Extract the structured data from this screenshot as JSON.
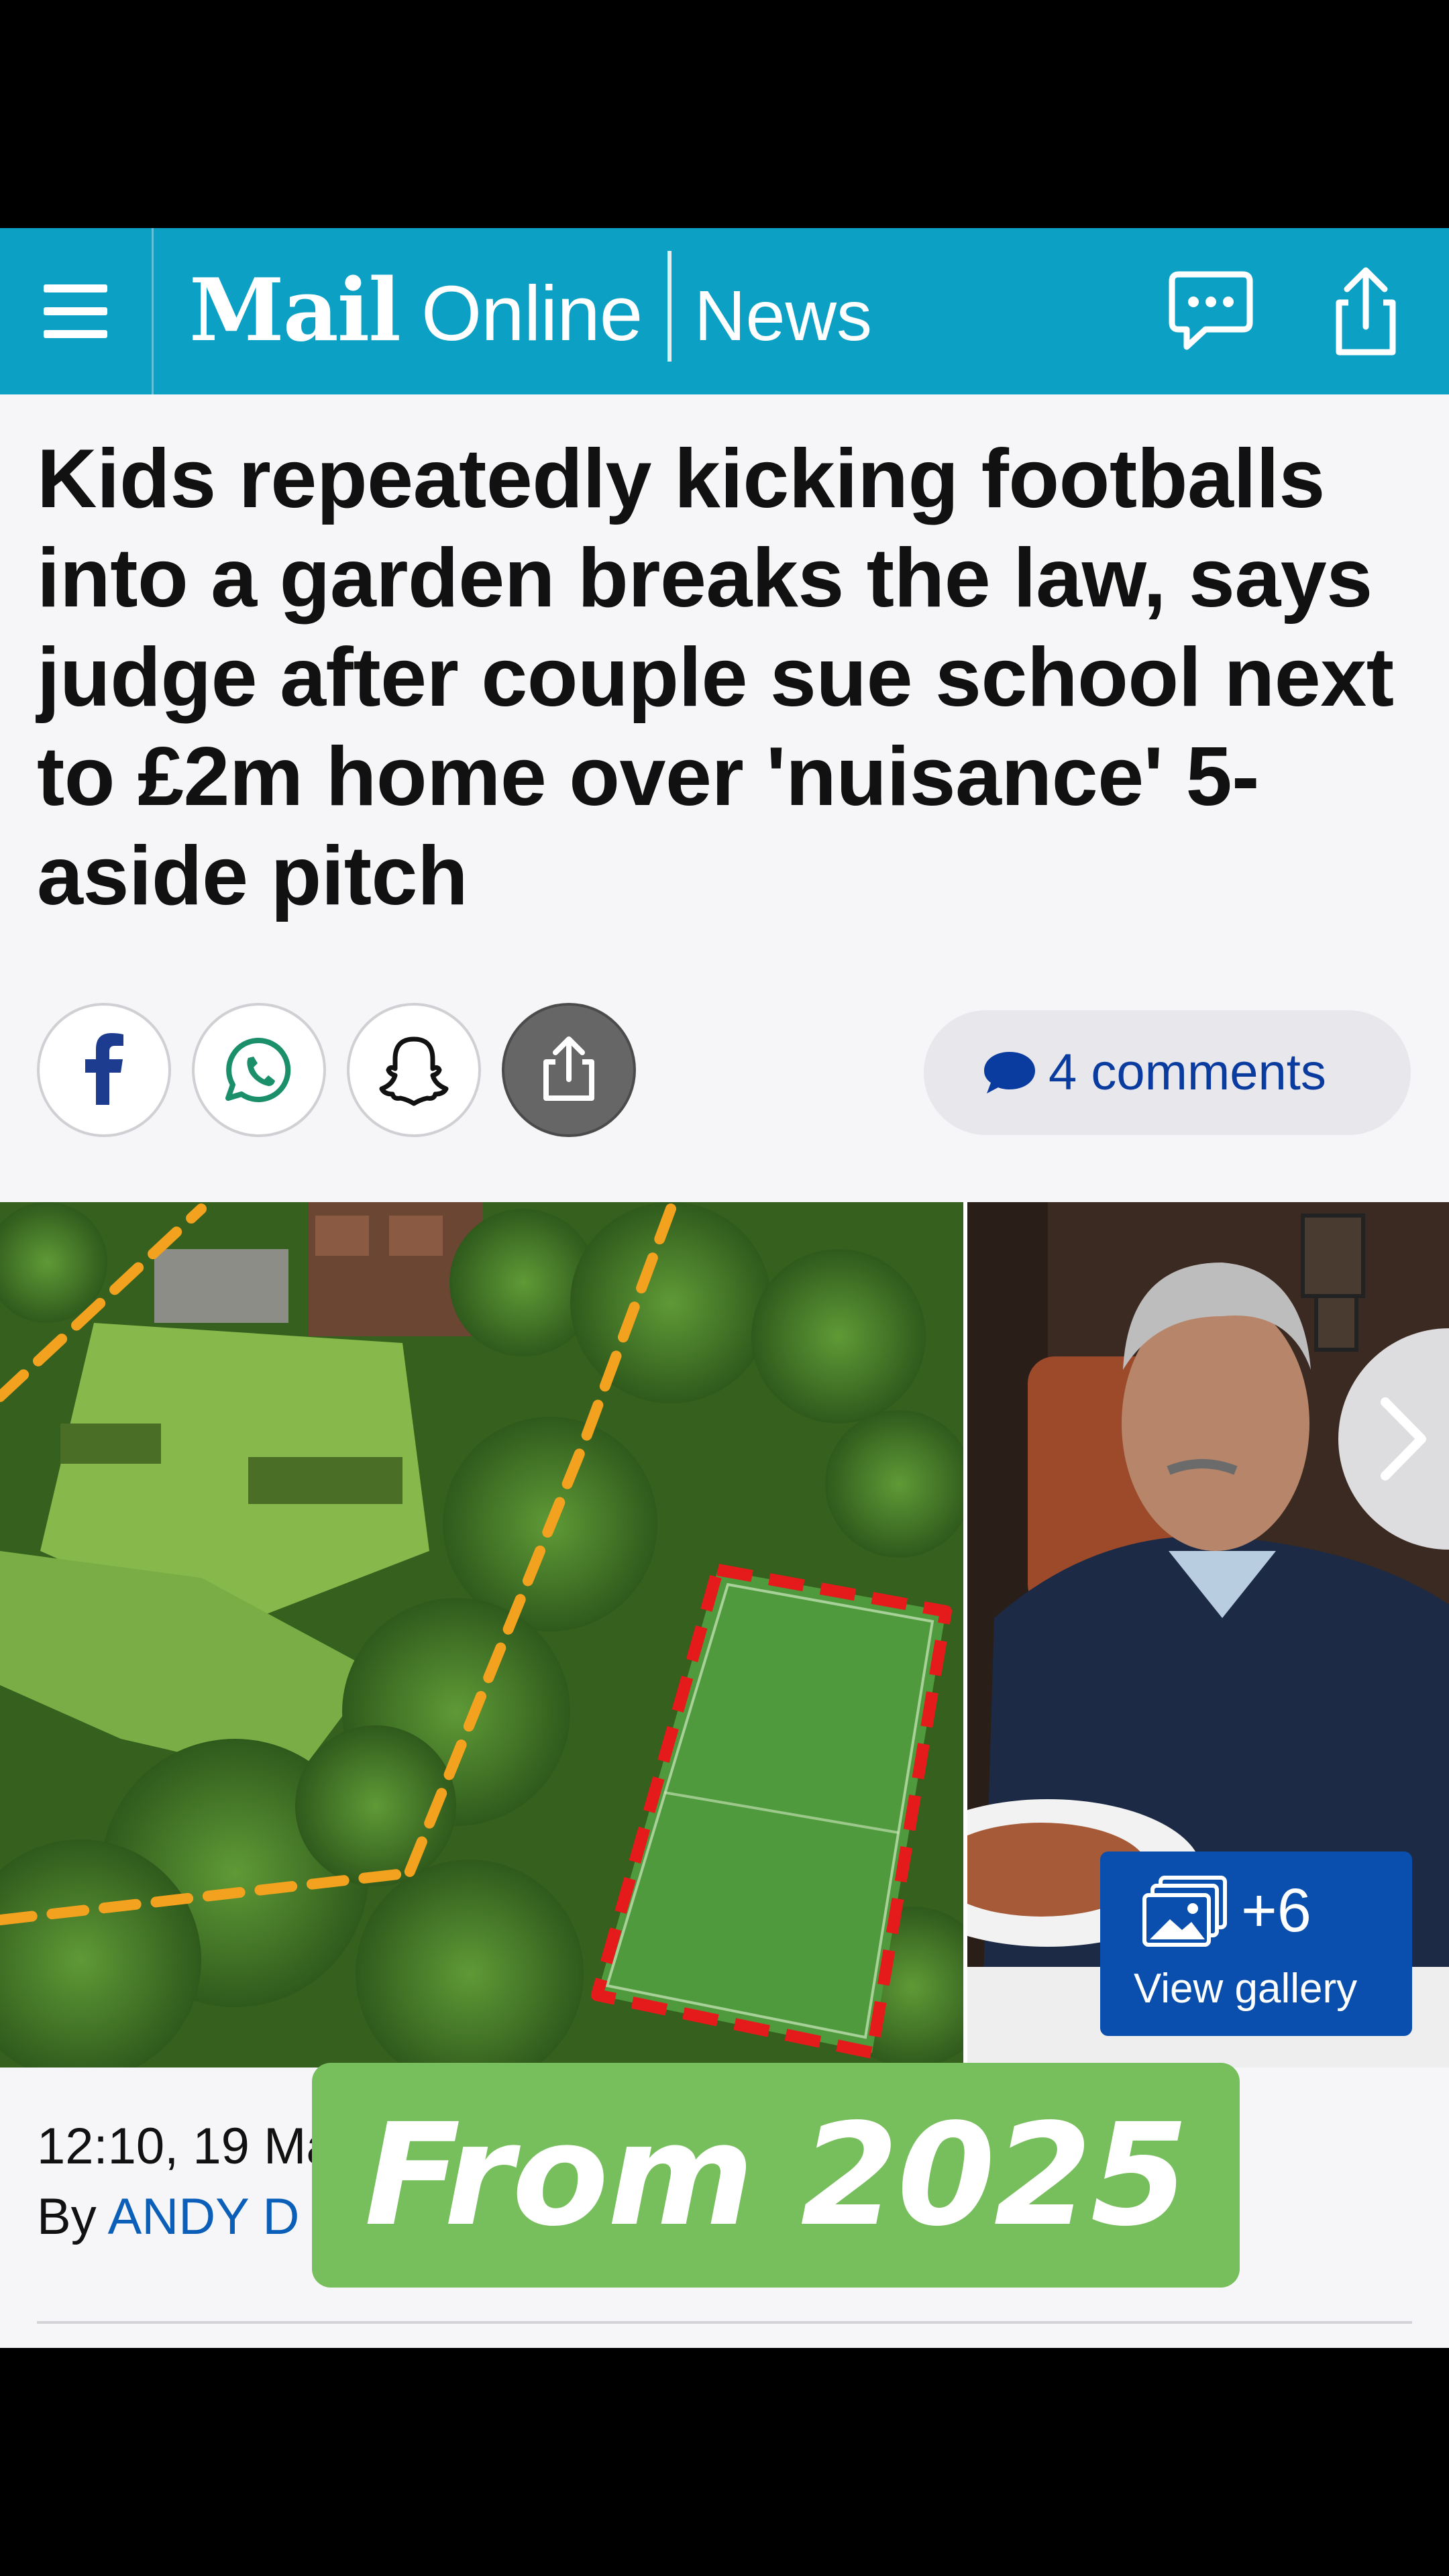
{
  "header": {
    "logo_mail": "Mail",
    "logo_online": "Online",
    "section": "News",
    "brand_color": "#0ba0c4"
  },
  "article": {
    "headline": "Kids repeatedly kicking footballs into a garden breaks the law, says judge after couple sue school next to £2m home over 'nuisance' 5-aside pitch",
    "comments_label": "4 comments",
    "gallery_count": "+6",
    "gallery_label": "View gallery",
    "time_visible": "12:10, 19 Ma",
    "by_prefix": "By ",
    "author_visible": "ANDY D"
  },
  "share_icons": [
    "facebook-icon",
    "whatsapp-icon",
    "snapchat-icon",
    "share-icon"
  ],
  "overlay": {
    "text": "From 2025",
    "color": "#76bf5c"
  }
}
